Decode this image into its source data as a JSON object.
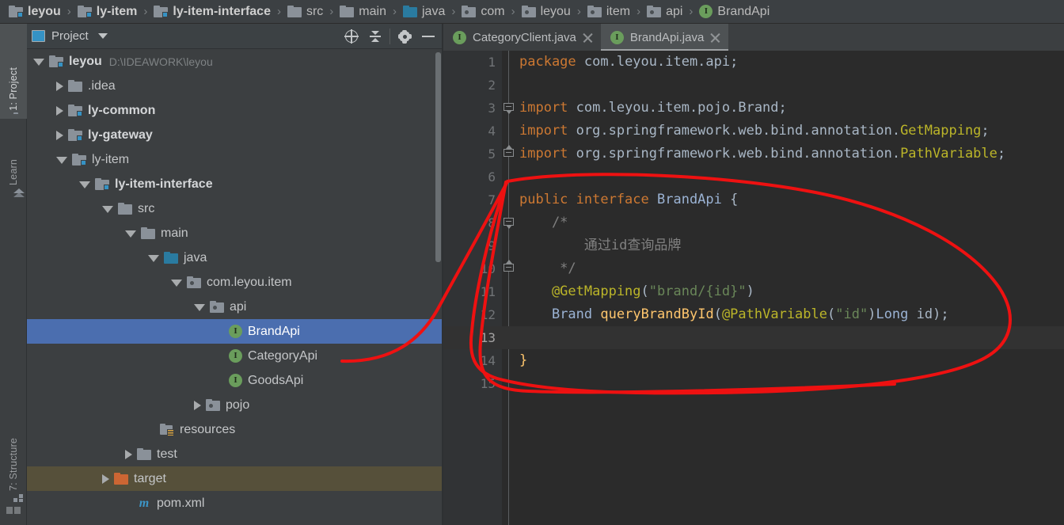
{
  "breadcrumb": {
    "items": [
      {
        "label": "leyou",
        "icon": "module-icon",
        "bold": true
      },
      {
        "label": "ly-item",
        "icon": "module-icon",
        "bold": true
      },
      {
        "label": "ly-item-interface",
        "icon": "module-icon",
        "bold": true
      },
      {
        "label": "src",
        "icon": "folder-icon",
        "bold": false
      },
      {
        "label": "main",
        "icon": "folder-icon",
        "bold": false
      },
      {
        "label": "java",
        "icon": "source-folder-icon",
        "bold": false
      },
      {
        "label": "com",
        "icon": "package-icon",
        "bold": false
      },
      {
        "label": "leyou",
        "icon": "package-icon",
        "bold": false
      },
      {
        "label": "item",
        "icon": "package-icon",
        "bold": false
      },
      {
        "label": "api",
        "icon": "package-icon",
        "bold": false
      },
      {
        "label": "BrandApi",
        "icon": "interface-icon",
        "bold": false
      }
    ],
    "separator": "›"
  },
  "toolstrip": {
    "tabs": [
      {
        "label": "1: Project",
        "icon": "folder-icon",
        "active": true
      },
      {
        "label": "Learn",
        "icon": "learn-icon",
        "active": false
      },
      {
        "label": "7: Structure",
        "icon": "structure-icon",
        "active": false
      }
    ]
  },
  "project_panel": {
    "title": "Project",
    "view_icon": "project-view-icon",
    "dropdown_icon": "chevron-down-icon",
    "actions": [
      {
        "name": "scroll-from-source-button",
        "icon": "target-icon"
      },
      {
        "name": "collapse-all-button",
        "icon": "collapse-all-icon"
      },
      {
        "name": "settings-button",
        "icon": "gear-icon"
      },
      {
        "name": "hide-button",
        "icon": "minus-icon"
      }
    ],
    "tree": [
      {
        "label": "leyou",
        "detail": "D:\\IDEAWORK\\leyou",
        "icon": "module-icon",
        "indent": 0,
        "state": "open",
        "bold": true,
        "selected": false,
        "excluded": false
      },
      {
        "label": ".idea",
        "detail": "",
        "icon": "folder-icon",
        "indent": 1,
        "state": "closed",
        "bold": false,
        "selected": false,
        "excluded": false
      },
      {
        "label": "ly-common",
        "detail": "",
        "icon": "module-icon",
        "indent": 1,
        "state": "closed",
        "bold": true,
        "selected": false,
        "excluded": false
      },
      {
        "label": "ly-gateway",
        "detail": "",
        "icon": "module-icon",
        "indent": 1,
        "state": "closed",
        "bold": true,
        "selected": false,
        "excluded": false
      },
      {
        "label": "ly-item",
        "detail": "",
        "icon": "module-icon",
        "indent": 1,
        "state": "open",
        "bold": false,
        "selected": false,
        "excluded": false
      },
      {
        "label": "ly-item-interface",
        "detail": "",
        "icon": "module-icon",
        "indent": 2,
        "state": "open",
        "bold": true,
        "selected": false,
        "excluded": false
      },
      {
        "label": "src",
        "detail": "",
        "icon": "folder-icon",
        "indent": 3,
        "state": "open",
        "bold": false,
        "selected": false,
        "excluded": false
      },
      {
        "label": "main",
        "detail": "",
        "icon": "folder-icon",
        "indent": 4,
        "state": "open",
        "bold": false,
        "selected": false,
        "excluded": false
      },
      {
        "label": "java",
        "detail": "",
        "icon": "source-folder-icon",
        "indent": 5,
        "state": "open",
        "bold": false,
        "selected": false,
        "excluded": false
      },
      {
        "label": "com.leyou.item",
        "detail": "",
        "icon": "package-icon",
        "indent": 6,
        "state": "open",
        "bold": false,
        "selected": false,
        "excluded": false
      },
      {
        "label": "api",
        "detail": "",
        "icon": "package-icon",
        "indent": 7,
        "state": "open",
        "bold": false,
        "selected": false,
        "excluded": false
      },
      {
        "label": "BrandApi",
        "detail": "",
        "icon": "interface-icon",
        "indent": 8,
        "state": "leaf",
        "bold": false,
        "selected": true,
        "excluded": false
      },
      {
        "label": "CategoryApi",
        "detail": "",
        "icon": "interface-icon",
        "indent": 8,
        "state": "leaf",
        "bold": false,
        "selected": false,
        "excluded": false
      },
      {
        "label": "GoodsApi",
        "detail": "",
        "icon": "interface-icon",
        "indent": 8,
        "state": "leaf",
        "bold": false,
        "selected": false,
        "excluded": false
      },
      {
        "label": "pojo",
        "detail": "",
        "icon": "package-icon",
        "indent": 7,
        "state": "closed",
        "bold": false,
        "selected": false,
        "excluded": false
      },
      {
        "label": "resources",
        "detail": "",
        "icon": "resources-folder-icon",
        "indent": 5,
        "state": "leaf",
        "bold": false,
        "selected": false,
        "excluded": false
      },
      {
        "label": "test",
        "detail": "",
        "icon": "folder-icon",
        "indent": 4,
        "state": "closed",
        "bold": false,
        "selected": false,
        "excluded": false
      },
      {
        "label": "target",
        "detail": "",
        "icon": "excluded-folder-icon",
        "indent": 3,
        "state": "closed",
        "bold": false,
        "selected": false,
        "excluded": true
      },
      {
        "label": "pom.xml",
        "detail": "",
        "icon": "maven-icon",
        "indent": 4,
        "state": "leaf",
        "bold": false,
        "selected": false,
        "excluded": false
      }
    ]
  },
  "editor": {
    "tabs": [
      {
        "label": "CategoryClient.java",
        "icon": "interface-icon",
        "active": false,
        "close_icon": "close-icon"
      },
      {
        "label": "BrandApi.java",
        "icon": "interface-icon",
        "active": true,
        "close_icon": "close-icon"
      }
    ],
    "code_lines": [
      {
        "number": "1",
        "current": false,
        "fold": "",
        "tokens": [
          {
            "t": "package",
            "c": "kw"
          },
          {
            "t": " com.leyou.item.api;",
            "c": "pl"
          }
        ]
      },
      {
        "number": "2",
        "current": false,
        "fold": "",
        "tokens": []
      },
      {
        "number": "3",
        "current": false,
        "fold": "down",
        "tokens": [
          {
            "t": "import",
            "c": "kw"
          },
          {
            "t": " com.leyou.item.pojo.Brand;",
            "c": "pl"
          }
        ]
      },
      {
        "number": "4",
        "current": false,
        "fold": "",
        "tokens": [
          {
            "t": "import",
            "c": "kw"
          },
          {
            "t": " org.springframework.web.bind.annotation.",
            "c": "pl"
          },
          {
            "t": "GetMapping",
            "c": "ann"
          },
          {
            "t": ";",
            "c": "pl"
          }
        ]
      },
      {
        "number": "5",
        "current": false,
        "fold": "up",
        "tokens": [
          {
            "t": "import",
            "c": "kw"
          },
          {
            "t": " org.springframework.web.bind.annotation.",
            "c": "pl"
          },
          {
            "t": "PathVariable",
            "c": "ann"
          },
          {
            "t": ";",
            "c": "pl"
          }
        ]
      },
      {
        "number": "6",
        "current": false,
        "fold": "",
        "tokens": []
      },
      {
        "number": "7",
        "current": false,
        "fold": "",
        "tokens": [
          {
            "t": "public interface ",
            "c": "kw"
          },
          {
            "t": "BrandApi",
            "c": "type"
          },
          {
            "t": " {",
            "c": "pl"
          }
        ]
      },
      {
        "number": "8",
        "current": false,
        "fold": "down",
        "tokens": [
          {
            "t": "    /*",
            "c": "cmt"
          }
        ]
      },
      {
        "number": "9",
        "current": false,
        "fold": "",
        "tokens": [
          {
            "t": "        通过id查询品牌",
            "c": "cmt"
          }
        ]
      },
      {
        "number": "10",
        "current": false,
        "fold": "up",
        "tokens": [
          {
            "t": "     */",
            "c": "cmt"
          }
        ]
      },
      {
        "number": "11",
        "current": false,
        "fold": "",
        "tokens": [
          {
            "t": "    @GetMapping",
            "c": "ann"
          },
          {
            "t": "(",
            "c": "pl"
          },
          {
            "t": "\"brand/{id}\"",
            "c": "str"
          },
          {
            "t": ")",
            "c": "pl"
          }
        ]
      },
      {
        "number": "12",
        "current": false,
        "fold": "",
        "tokens": [
          {
            "t": "    ",
            "c": "pl"
          },
          {
            "t": "Brand",
            "c": "type"
          },
          {
            "t": " ",
            "c": "pl"
          },
          {
            "t": "queryBrandById",
            "c": "mth"
          },
          {
            "t": "(",
            "c": "pl"
          },
          {
            "t": "@PathVariable",
            "c": "ann"
          },
          {
            "t": "(",
            "c": "pl"
          },
          {
            "t": "\"id\"",
            "c": "str"
          },
          {
            "t": ")",
            "c": "pl"
          },
          {
            "t": "Long",
            "c": "type"
          },
          {
            "t": " id);",
            "c": "pl"
          }
        ]
      },
      {
        "number": "13",
        "current": true,
        "fold": "",
        "tokens": []
      },
      {
        "number": "14",
        "current": false,
        "fold": "",
        "tokens": [
          {
            "t": "}",
            "c": "brace"
          }
        ]
      },
      {
        "number": "15",
        "current": false,
        "fold": "",
        "tokens": []
      }
    ]
  },
  "annotation": {
    "name": "red-handdrawn-loop",
    "color": "#ee1111",
    "stroke_width": 4
  },
  "colors": {
    "selection_blue": "#4b6eaf",
    "excluded_brown": "#56503a",
    "editor_bg": "#2b2b2b",
    "panel_bg": "#3c3f41",
    "keyword_orange": "#cc7832",
    "string_green": "#6a8759",
    "annotation_yellow": "#bbb529",
    "method_yellow": "#ffc66d",
    "type_blue": "#9bb3d4",
    "comment_gray": "#808080"
  }
}
